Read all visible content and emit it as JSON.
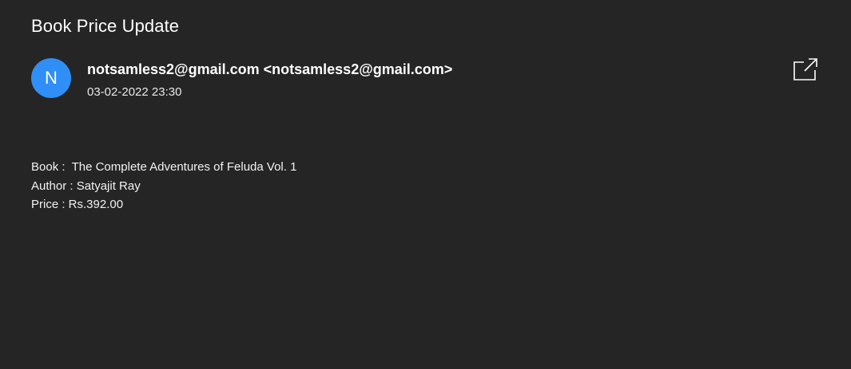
{
  "email": {
    "subject": "Book Price Update",
    "avatar_letter": "N",
    "sender": "notsamless2@gmail.com <notsamless2@gmail.com>",
    "date": "03-02-2022 23:30",
    "popout_icon": "open-in-new-window-icon",
    "body_lines": [
      "Book :  The Complete Adventures of Feluda Vol. 1",
      "Author : Satyajit Ray",
      "Price : Rs.392.00"
    ]
  },
  "colors": {
    "background": "#252525",
    "avatar": "#2f8ff7",
    "text": "#ffffff"
  }
}
